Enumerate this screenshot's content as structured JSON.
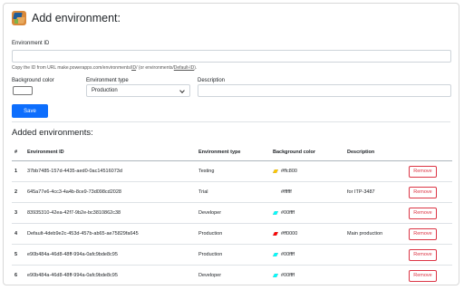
{
  "header": {
    "title": "Add environment:"
  },
  "form": {
    "environment_id_label": "Environment ID",
    "environment_id_value": "",
    "hint_prefix": "Copy the ID from URL make.powerapps.com/environments/",
    "hint_id": "ID",
    "hint_middle": "/ (or environments/",
    "hint_default": "Default-ID",
    "hint_suffix": ").",
    "background_color_label": "Background color",
    "background_color_value": "#ffffff",
    "environment_type_label": "Environment type",
    "environment_type_value": "Production",
    "description_label": "Description",
    "description_value": "",
    "save_label": "Save"
  },
  "list": {
    "title": "Added environments:",
    "columns": {
      "num": "#",
      "id": "Environment ID",
      "type": "Environment type",
      "color": "Background color",
      "desc": "Description"
    },
    "remove_label": "Remove",
    "rows": [
      {
        "num": "1",
        "id": "37bb7485-157d-4435-aed0-0ac14516073d",
        "type": "Testing",
        "color": "#ffc800",
        "desc": "",
        "icon": "palette-icon"
      },
      {
        "num": "2",
        "id": "645a77e6-4cc3-4a4b-8ce9-73d098cd2028",
        "type": "Trial",
        "color": "#ffffff",
        "desc": "for ITP-3487",
        "icon": ""
      },
      {
        "num": "3",
        "id": "83935310-42ea-42f7-9b2e-bc3810862c38",
        "type": "Developer",
        "color": "#00ffff",
        "desc": "",
        "icon": "palette-icon"
      },
      {
        "num": "4",
        "id": "Default-4deb9e2c-453d-457b-ab65-ae75829fa645",
        "type": "Production",
        "color": "#ff0000",
        "desc": "Main production",
        "icon": "palette-icon"
      },
      {
        "num": "5",
        "id": "e90b484a-46d8-48ff-994a-0afc9bde8c95",
        "type": "Production",
        "color": "#00ffff",
        "desc": "",
        "icon": "palette-icon"
      },
      {
        "num": "6",
        "id": "e90b484a-46d8-48ff-994a-0afc9bde8c95",
        "type": "Developer",
        "color": "#00ffff",
        "desc": "",
        "icon": "palette-icon"
      }
    ]
  },
  "colors": {
    "primary": "#0d6efd",
    "danger": "#dc3545"
  }
}
